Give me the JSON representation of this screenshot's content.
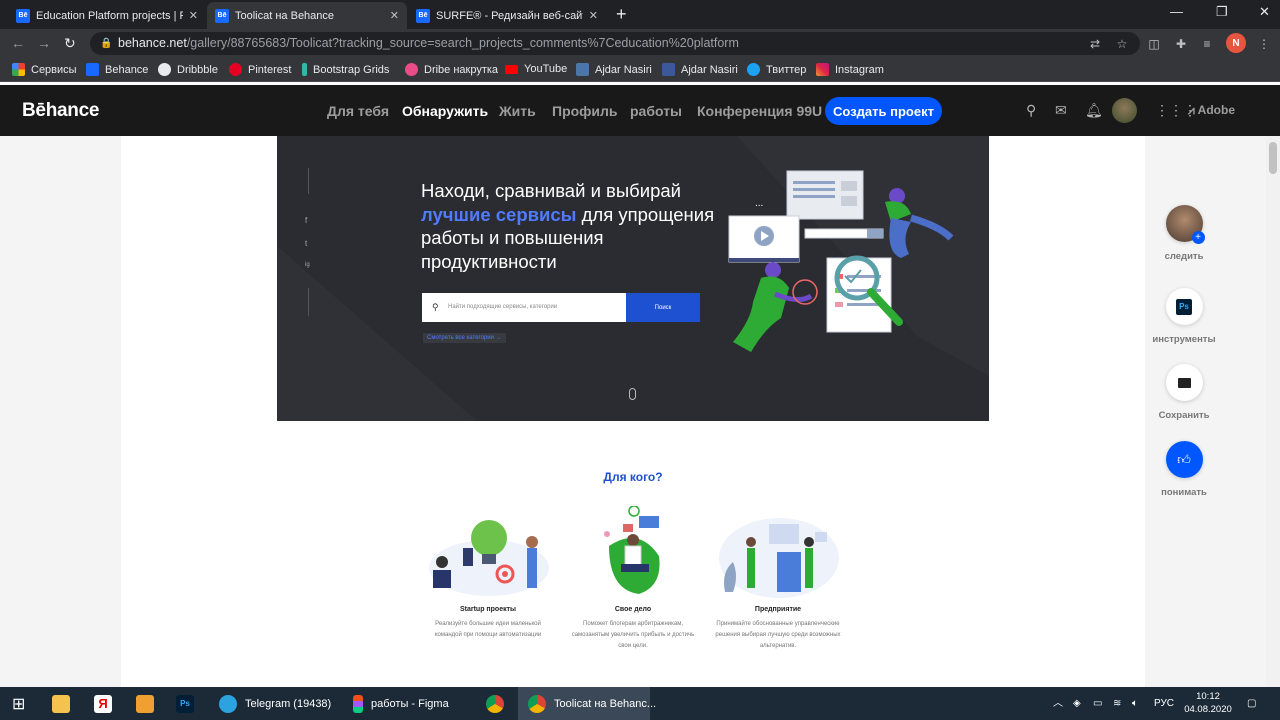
{
  "browser": {
    "tabs": [
      {
        "label": "Education Platform projects | Phot",
        "favicon": "Bē"
      },
      {
        "label": "Toolicat на Behance",
        "favicon": "Bē"
      },
      {
        "label": "SURFE® - Редизайн веб-сайта х",
        "favicon": "Bē"
      }
    ],
    "url_host": "behance.net",
    "url_path": "/gallery/88765683/Toolicat?tracking_source=search_projects_comments%7Ceducation%20platform",
    "profile_initial": "N",
    "bookmarks": [
      {
        "label": "Сервисы",
        "color": "#e94235"
      },
      {
        "label": "Behance",
        "color": "#1769ff"
      },
      {
        "label": "Dribbble",
        "color": "#ea4c89"
      },
      {
        "label": "Pinterest",
        "color": "#e60023"
      },
      {
        "label": "Bootstrap Grids",
        "color": "#2fb8a6"
      },
      {
        "label": "Dribe накрутка",
        "color": "#ea4c89"
      },
      {
        "label": "YouTube",
        "color": "#ff0000"
      },
      {
        "label": "Ajdar Nasiri",
        "color": "#4a76a8"
      },
      {
        "label": "Ajdar Nasiri",
        "color": "#3b5998"
      },
      {
        "label": "Твиттер",
        "color": "#1da1f2"
      },
      {
        "label": "Instagram",
        "color": "#d6249f"
      }
    ]
  },
  "behance": {
    "logo": "Bēhance",
    "nav": [
      "Для тебя",
      "Обнаружить",
      "Жить",
      "Профиль",
      "работы",
      "Конференция 99U"
    ],
    "create_label": "Создать проект",
    "adobe_label": "Adobe"
  },
  "hero": {
    "headline_1": "Находи, сравнивай и выбирай",
    "headline_accent": "лучшие сервисы",
    "headline_2": " для упрощения работы и повышения продуктивности",
    "search_placeholder": "Найти подходящие сервисы, категории",
    "search_button": "Поиск",
    "all_categories": "Смотреть все категории",
    "social": [
      "f",
      "t",
      "ig"
    ]
  },
  "section": {
    "title": "Для кого?",
    "columns": [
      {
        "title": "Startup проекты",
        "desc": "Реализуйте большие идеи маленькой командой при помощи автоматизации"
      },
      {
        "title": "Свое дело",
        "desc": "Поможет блогерам арбитражникам, самозанятым увеличить прибыль и достичь свои цели."
      },
      {
        "title": "Предприятие",
        "desc": "Принимайте обоснованные управленческие решения выбирая лучшую среди возможных альтернатив."
      }
    ]
  },
  "rail": [
    {
      "label": "следить"
    },
    {
      "label": "инструменты"
    },
    {
      "label": "Сохранить"
    },
    {
      "label": "понимать"
    }
  ],
  "taskbar": {
    "apps": [
      {
        "label": "Telegram (19438)",
        "color": "#2aa3e0"
      },
      {
        "label": "работы - Figma",
        "color": "#a259ff"
      },
      {
        "label": "",
        "color": "#4285f4"
      },
      {
        "label": "Toolicat на Behanc...",
        "color": "#db4437"
      }
    ],
    "lang": "РУС",
    "time": "10:12",
    "date": "04.08.2020"
  },
  "colors": {
    "accent": "#0057ff",
    "hero_bg": "#2b2c31",
    "accent_text": "#4f7bff"
  }
}
